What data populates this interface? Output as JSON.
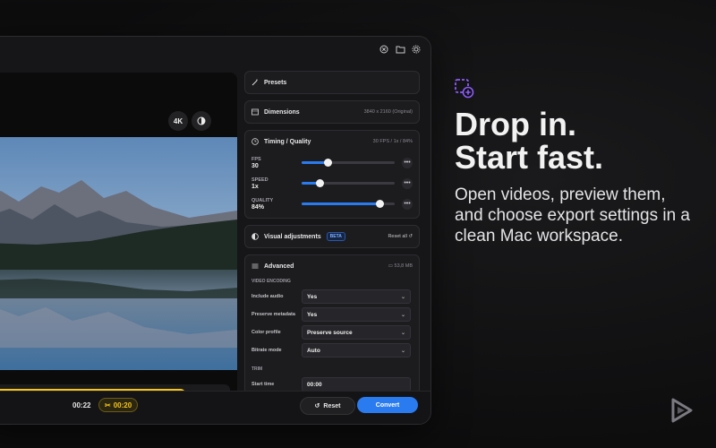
{
  "preview": {
    "badge_4k": "4K",
    "time": "00:22",
    "trim_duration": "00:20"
  },
  "actions": {
    "reset": "Reset",
    "convert": "Convert"
  },
  "panel": {
    "presets": "Presets",
    "dimensions": {
      "label": "Dimensions",
      "value": "3840 x 2160 (Original)"
    },
    "timing": {
      "label": "Timing / Quality",
      "summary": "30 FPS / 1x / 84%",
      "fps": {
        "label": "FPS",
        "value": "30",
        "level": 0.28
      },
      "speed": {
        "label": "SPEED",
        "value": "1x",
        "level": 0.19
      },
      "quality": {
        "label": "QUALITY",
        "value": "84%",
        "level": 0.84
      }
    },
    "visual": {
      "label": "Visual adjustments",
      "beta": "BETA",
      "reset_all": "Reset all"
    },
    "advanced": {
      "label": "Advanced",
      "size": "53,8 MB",
      "video_encoding": "VIDEO ENCODING",
      "include_audio": {
        "label": "Include audio",
        "value": "Yes"
      },
      "preserve_metadata": {
        "label": "Preserve metadata",
        "value": "Yes"
      },
      "color_profile": {
        "label": "Color profile",
        "value": "Preserve source"
      },
      "bitrate_mode": {
        "label": "Bitrate mode",
        "value": "Auto"
      },
      "trim": "TRIM",
      "start_time": {
        "label": "Start time",
        "value": "00:00"
      }
    }
  },
  "hero": {
    "headline_line1": "Drop in.",
    "headline_line2": "Start fast.",
    "subtitle": "Open videos, preview them, and choose export settings in a clean Mac workspace."
  },
  "colors": {
    "accent": "#2a7bf0",
    "trim": "#f5c518",
    "brand_icon": "#8b5cf6"
  }
}
